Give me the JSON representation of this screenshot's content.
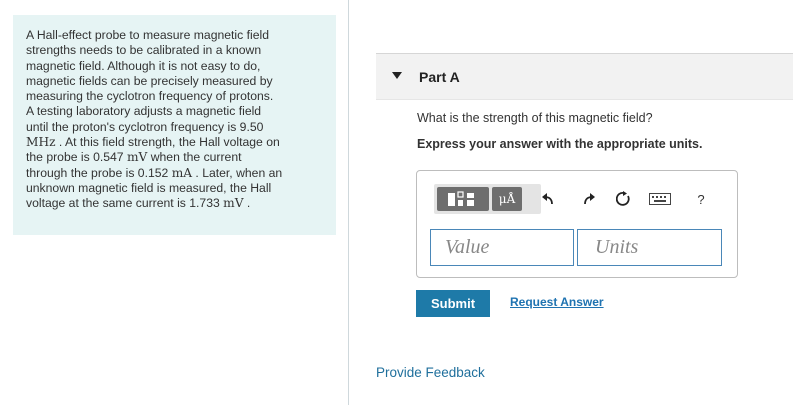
{
  "problem": {
    "lines": [
      "A Hall-effect probe to measure magnetic field",
      "strengths needs to be calibrated in a known",
      "magnetic field. Although it is not easy to do,",
      "magnetic fields can be precisely measured by",
      "measuring the cyclotron frequency of protons.",
      "A testing laboratory adjusts a magnetic field",
      "until the proton's cyclotron frequency is 9.50"
    ],
    "line8_unit": "MHz",
    "line8_rest": " . At this field strength, the Hall voltage on",
    "line9_pre": "the probe is 0.547 ",
    "line9_unit": "mV",
    "line9_post": " when the current",
    "line10_pre": "through the probe is 0.152 ",
    "line10_unit": "mA",
    "line10_post": " . Later, when an",
    "line11": "unknown magnetic field is measured, the Hall",
    "line12_pre": "voltage at the same current is 1.733 ",
    "line12_unit": "mV",
    "line12_post": " ."
  },
  "part": {
    "title": "Part A"
  },
  "question": "What is the strength of this magnetic field?",
  "instruction": "Express your answer with the appropriate units.",
  "toolbar": {
    "units_label": "μÅ",
    "help_label": "?",
    "icons": [
      "templates-icon",
      "units-icon",
      "undo-icon",
      "redo-icon",
      "reset-icon",
      "keyboard-icon",
      "help-icon"
    ]
  },
  "inputs": {
    "value_placeholder": "Value",
    "units_placeholder": "Units"
  },
  "actions": {
    "submit_label": "Submit",
    "request_answer_label": "Request Answer"
  },
  "footer": {
    "feedback_label": "Provide Feedback"
  },
  "colors": {
    "problem_bg": "#e6f4f4",
    "submit_bg": "#1e7aa8",
    "link": "#1f73b1",
    "input_border": "#4a87b8"
  }
}
